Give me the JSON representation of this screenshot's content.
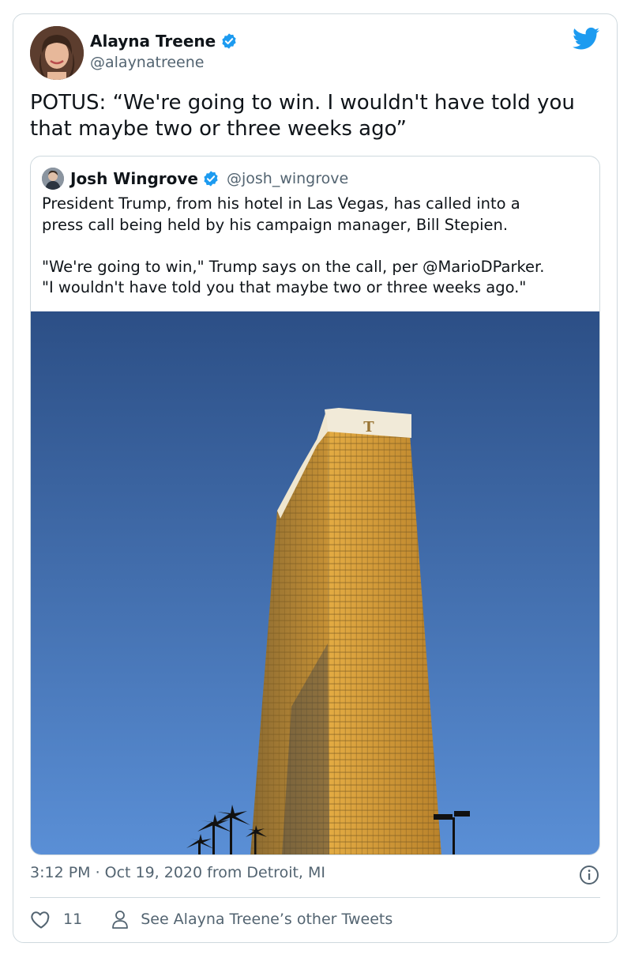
{
  "author": {
    "name": "Alayna Treene",
    "handle": "@alaynatreene",
    "verified": true
  },
  "tweet": {
    "text": "POTUS: “We're going to win. I wouldn't have told you\nthat maybe two or three weeks ago”"
  },
  "quoted_tweet": {
    "author_name": "Josh Wingrove",
    "author_handle": "@josh_wingrove",
    "verified": true,
    "text": "President Trump, from his hotel in Las Vegas, has called into a\npress call being held by his campaign manager, Bill Stepien.\n\n\"We're going to win,\" Trump says on the call, per @MarioDParker.\n\"I wouldn't have told you that maybe two or three weeks ago.\"",
    "image_sign_letter": "T"
  },
  "meta": {
    "time": "3:12 PM",
    "separator": "·",
    "date_source": "Oct 19, 2020 from Detroit, MI"
  },
  "actions": {
    "like_count": "11",
    "other_tweets_label": "See Alayna Treene’s other Tweets"
  },
  "icons": {
    "brand": "twitter-bird-icon",
    "verified": "verified-badge-icon",
    "info": "info-icon",
    "like": "heart-icon",
    "profile": "person-icon"
  },
  "colors": {
    "twitter_blue": "#1d9bf0",
    "text_primary": "#0f1419",
    "text_secondary": "#536471",
    "border": "#cfd9de",
    "sky_top": "#2c4f86",
    "sky_bottom": "#5a8fd6",
    "tower_gold": "#d9a23a"
  }
}
